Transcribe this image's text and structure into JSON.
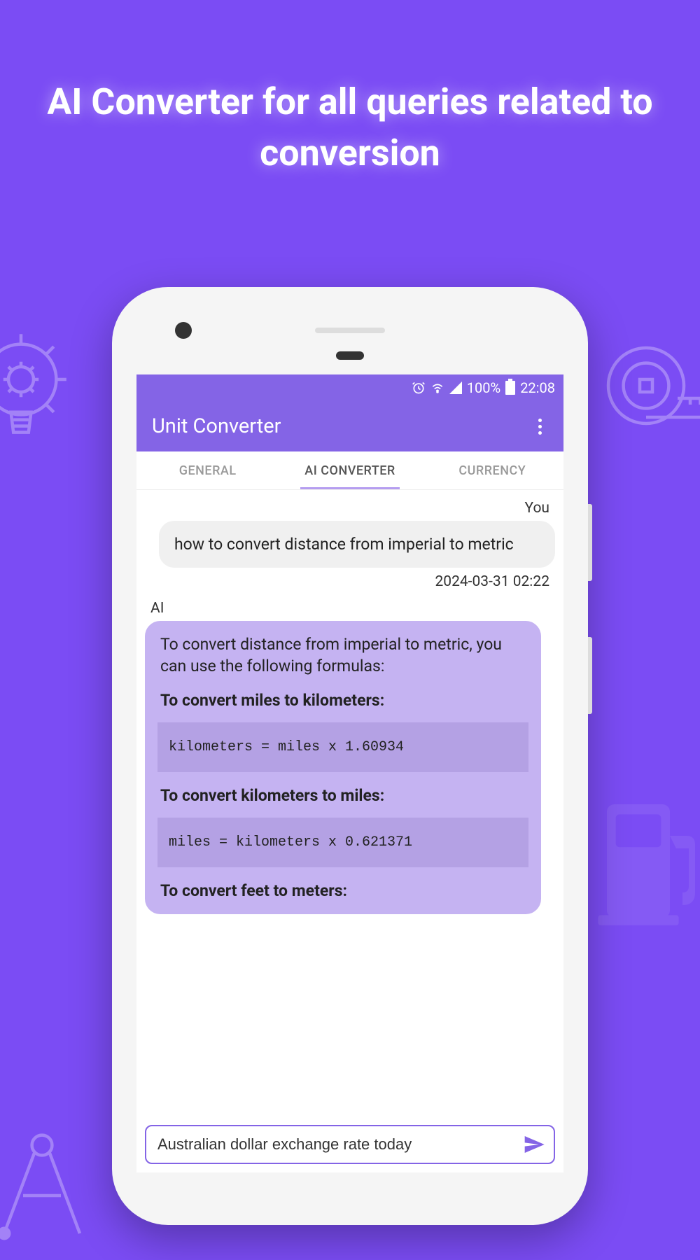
{
  "marketing": {
    "headline": "AI Converter for all queries related to conversion"
  },
  "statusBar": {
    "battery": "100%",
    "time": "22:08"
  },
  "appBar": {
    "title": "Unit Converter"
  },
  "tabs": {
    "general": "GENERAL",
    "aiConverter": "AI CONVERTER",
    "currency": "CURRENCY"
  },
  "chat": {
    "userLabel": "You",
    "userMessage": "how to convert distance from imperial to metric",
    "userTimestamp": "2024-03-31 02:22",
    "aiLabel": "AI",
    "aiIntro": "To convert distance from imperial to metric, you can use the following formulas:",
    "heading1": "To convert miles to kilometers:",
    "code1": "kilometers = miles x 1.60934",
    "heading2": "To convert kilometers to miles:",
    "code2": "miles = kilometers x 0.621371",
    "heading3": "To convert feet to meters:"
  },
  "input": {
    "value": "Australian dollar exchange rate today"
  }
}
